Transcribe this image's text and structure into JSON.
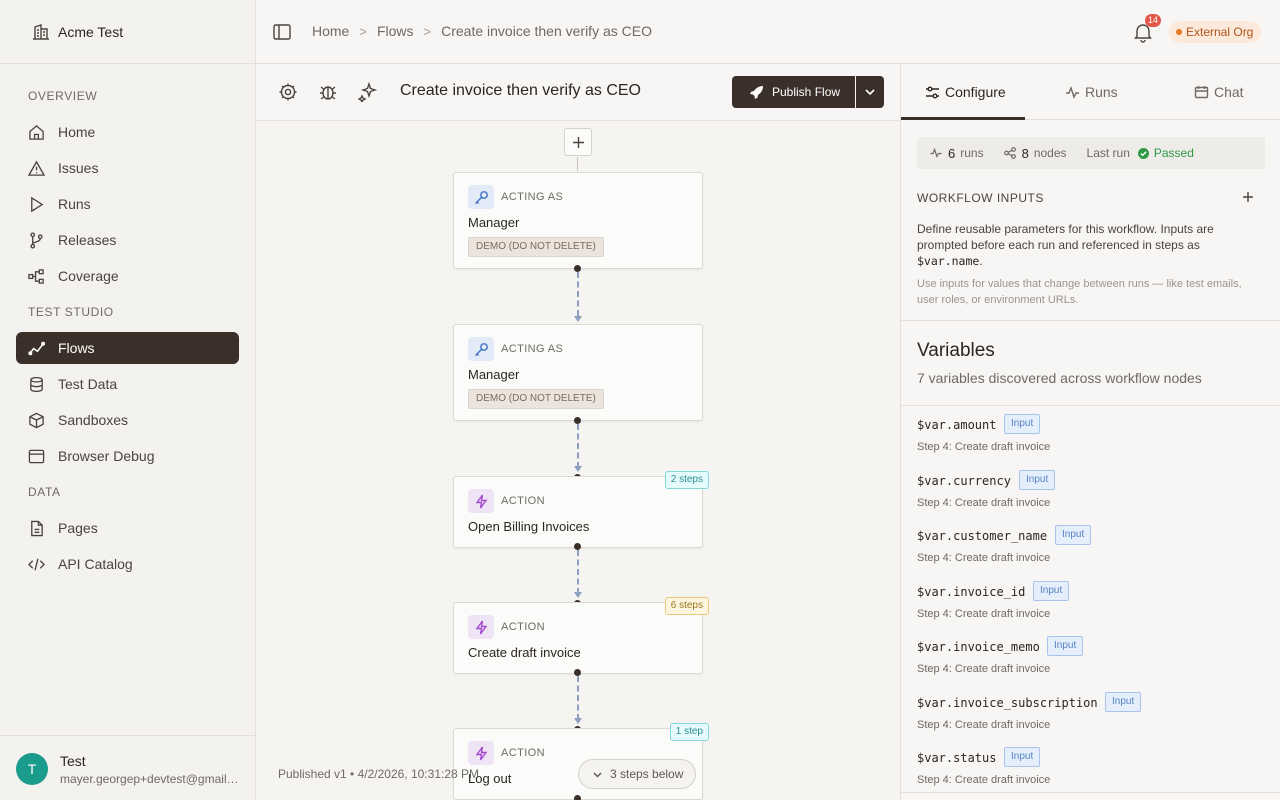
{
  "org": {
    "name": "Acme Test"
  },
  "sidebar": {
    "sections": [
      "OVERVIEW",
      "TEST STUDIO",
      "DATA"
    ],
    "items": [
      {
        "label": "Home",
        "icon": "home-icon"
      },
      {
        "label": "Issues",
        "icon": "warning-icon"
      },
      {
        "label": "Runs",
        "icon": "play-icon"
      },
      {
        "label": "Releases",
        "icon": "branch-icon"
      },
      {
        "label": "Coverage",
        "icon": "network-icon"
      },
      {
        "label": "Flows",
        "icon": "flow-icon",
        "active": true
      },
      {
        "label": "Test Data",
        "icon": "database-icon"
      },
      {
        "label": "Sandboxes",
        "icon": "box-icon"
      },
      {
        "label": "Browser Debug",
        "icon": "browser-icon"
      },
      {
        "label": "Pages",
        "icon": "file-icon"
      },
      {
        "label": "API Catalog",
        "icon": "code-icon"
      }
    ]
  },
  "user": {
    "initial": "T",
    "name": "Test",
    "email": "mayer.georgep+devtest@gmail.com"
  },
  "breadcrumb": [
    "Home",
    "Flows",
    "Create invoice then verify as CEO"
  ],
  "notifications": {
    "count": "14"
  },
  "org_badge": {
    "label": "External Org",
    "color": "#e7761e"
  },
  "flow": {
    "title": "Create invoice then verify as CEO",
    "publish_label": "Publish Flow",
    "nodes": [
      {
        "type": "ACTING AS",
        "title": "Manager",
        "tag": "DEMO (DO NOT DELETE)"
      },
      {
        "type": "ACTING AS",
        "title": "Manager",
        "tag": "DEMO (DO NOT DELETE)"
      },
      {
        "type": "ACTION",
        "title": "Open Billing Invoices",
        "steps": "2 steps"
      },
      {
        "type": "ACTION",
        "title": "Create draft invoice",
        "steps": "6 steps"
      },
      {
        "type": "ACTION",
        "title": "Log out",
        "steps": "1 step"
      }
    ],
    "status": "Published v1 • 4/2/2026, 10:31:28 PM",
    "below_label": "3 steps below"
  },
  "panel": {
    "tabs": [
      "Configure",
      "Runs",
      "Chat"
    ],
    "stats": {
      "runs": "6",
      "runs_label": "runs",
      "nodes": "8",
      "nodes_label": "nodes",
      "last_run_label": "Last run",
      "last_run_status": "Passed"
    },
    "workflow_inputs": {
      "title": "WORKFLOW INPUTS",
      "desc": "Define reusable parameters for this workflow. Inputs are prompted before each run and referenced in steps as",
      "desc_code": "$var.name",
      "desc_end": ".",
      "hint": "Use inputs for values that change between runs — like test emails, user roles, or environment URLs."
    },
    "variables": {
      "title": "Variables",
      "subtitle": "7 variables discovered across workflow nodes",
      "items": [
        {
          "name": "$var.amount",
          "badge": "Input",
          "step": "Step 4: Create draft invoice"
        },
        {
          "name": "$var.currency",
          "badge": "Input",
          "step": "Step 4: Create draft invoice"
        },
        {
          "name": "$var.customer_name",
          "badge": "Input",
          "step": "Step 4: Create draft invoice"
        },
        {
          "name": "$var.invoice_id",
          "badge": "Input",
          "step": "Step 4: Create draft invoice"
        },
        {
          "name": "$var.invoice_memo",
          "badge": "Input",
          "step": "Step 4: Create draft invoice"
        },
        {
          "name": "$var.invoice_subscription",
          "badge": "Input",
          "step": "Step 4: Create draft invoice"
        },
        {
          "name": "$var.status",
          "badge": "Input",
          "step": "Step 4: Create draft invoice"
        }
      ]
    }
  }
}
